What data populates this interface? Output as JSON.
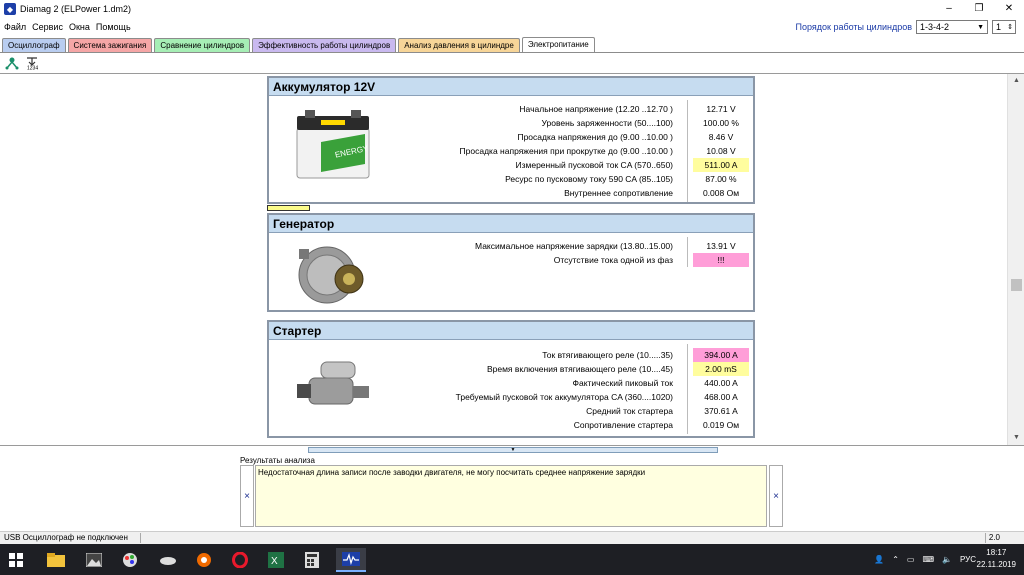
{
  "window": {
    "title": "Diamag 2 (ELPower 1.dm2)"
  },
  "menu": [
    "Файл",
    "Сервис",
    "Окна",
    "Помощь"
  ],
  "cylinder_order": {
    "label": "Порядок работы цилиндров",
    "value": "1-3-4-2",
    "spin": "1"
  },
  "tabs": [
    {
      "label": "Осциллограф",
      "color": "#b9cdf0"
    },
    {
      "label": "Система зажигания",
      "color": "#f5a6a6"
    },
    {
      "label": "Сравнение цилиндров",
      "color": "#a6eeb5"
    },
    {
      "label": "Эффективность работы цилиндров",
      "color": "#c9b9ef"
    },
    {
      "label": "Анализ давления в цилиндре",
      "color": "#f7d598"
    },
    {
      "label": "Электропитание",
      "color": "#ffffff"
    }
  ],
  "battery": {
    "title": "Аккумулятор 12V",
    "rows": [
      {
        "label": "Начальное напряжение (12.20 ..12.70 )",
        "value": "12.71 V",
        "hl": ""
      },
      {
        "label": "Уровень заряженности (50....100)",
        "value": "100.00 %",
        "hl": ""
      },
      {
        "label": "Просадка напряжения до (9.00 ..10.00 )",
        "value": "8.46 V",
        "hl": ""
      },
      {
        "label": "Просадка напряжения при прокрутке до (9.00 ..10.00 )",
        "value": "10.08 V",
        "hl": ""
      },
      {
        "label": "Измеренный пусковой ток  CA (570..650)",
        "value": "511.00 A",
        "hl": "y"
      },
      {
        "label": "Ресурс по пусковому току  590 CA (85..105)",
        "value": "87.00 %",
        "hl": ""
      },
      {
        "label": "Внутреннее сопротивление",
        "value": "0.008 Ом",
        "hl": ""
      }
    ]
  },
  "generator": {
    "title": "Генератор",
    "rows": [
      {
        "label": "Максимальное напряжение зарядки  (13.80..15.00)",
        "value": "13.91 V",
        "hl": ""
      },
      {
        "label": "Отсутствие тока одной из фаз",
        "value": "!!!",
        "hl": "p"
      }
    ]
  },
  "starter": {
    "title": "Стартер",
    "rows": [
      {
        "label": "Ток втягивающего реле (10.....35)",
        "value": "394.00 A",
        "hl": "p"
      },
      {
        "label": "Время включения втягивающего реле (10....45)",
        "value": "2.00 mS",
        "hl": "y"
      },
      {
        "label": "Фактический пиковый ток",
        "value": "440.00 A",
        "hl": ""
      },
      {
        "label": "Требуемый пусковой ток аккумулятора  CA (360....1020)",
        "value": "468.00 A",
        "hl": ""
      },
      {
        "label": "Средний ток стартера",
        "value": "370.61 A",
        "hl": ""
      },
      {
        "label": "Сопротивление стартера",
        "value": "0.019 Ом",
        "hl": ""
      }
    ]
  },
  "battery_brand": "ENERGY",
  "results": {
    "caption": "Результаты анализа",
    "text": "Недостаточная длина записи после заводки двигателя, не могу посчитать среднее напряжение зарядки",
    "close": "×"
  },
  "status": {
    "left": "USB Осциллограф не подключен",
    "right": "2.0"
  },
  "taskbar": {
    "lang": "РУС",
    "time": "18:17",
    "date": "22.11.2019"
  }
}
